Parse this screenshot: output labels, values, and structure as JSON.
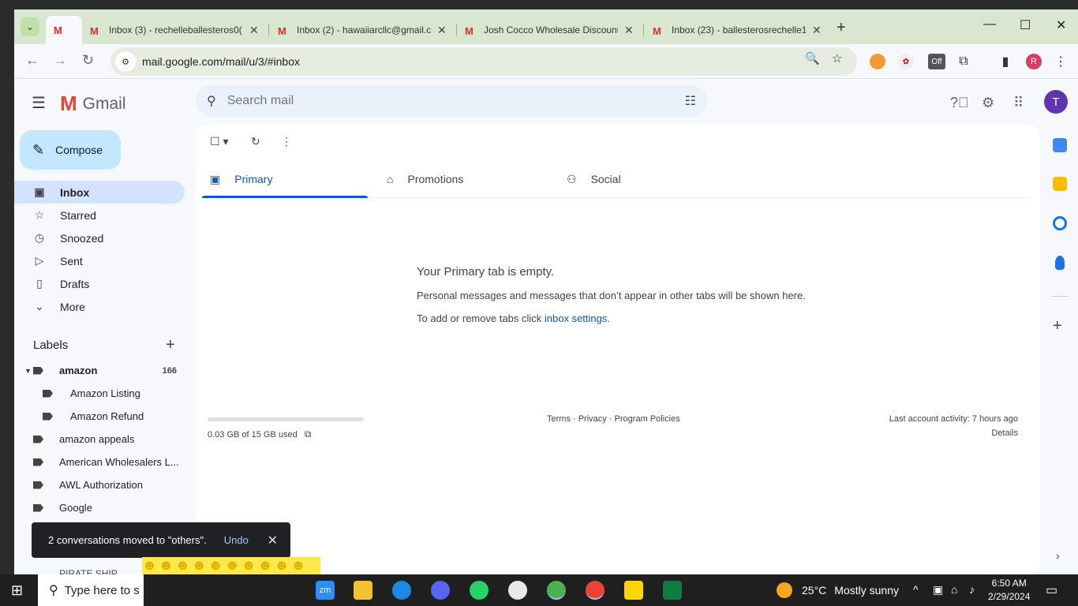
{
  "browser": {
    "tabs": [
      {
        "title": "",
        "active": true
      },
      {
        "title": "Inbox (3) - rechelleballesteros0(",
        "active": false
      },
      {
        "title": "Inbox (2) - hawaiiarcllc@gmail.c",
        "active": false
      },
      {
        "title": "Josh Cocco Wholesale Discount",
        "active": false
      },
      {
        "title": "Inbox (23) - ballesterosrechelle1",
        "active": false
      }
    ],
    "url": "mail.google.com/mail/u/3/#inbox",
    "profile_initial": "R",
    "ext_badge": "Off"
  },
  "gmail": {
    "brand": "Gmail",
    "search_placeholder": "Search mail",
    "avatar_initial": "T",
    "compose_label": "Compose",
    "nav": [
      {
        "label": "Inbox",
        "icon": "inbox-icon",
        "active": true
      },
      {
        "label": "Starred",
        "icon": "star-icon"
      },
      {
        "label": "Snoozed",
        "icon": "clock-icon"
      },
      {
        "label": "Sent",
        "icon": "send-icon"
      },
      {
        "label": "Drafts",
        "icon": "draft-icon"
      },
      {
        "label": "More",
        "icon": "chevron-down-icon"
      }
    ],
    "labels_title": "Labels",
    "labels": [
      {
        "label": "amazon",
        "count": "166",
        "expanded": true,
        "bold": true,
        "indent": 0
      },
      {
        "label": "Amazon Listing",
        "indent": 1
      },
      {
        "label": "Amazon Refund",
        "indent": 1
      },
      {
        "label": "amazon appeals",
        "indent": 0
      },
      {
        "label": "American Wholesalers L...",
        "indent": 0
      },
      {
        "label": "AWL Authorization",
        "indent": 0
      },
      {
        "label": "Google",
        "indent": 0
      }
    ],
    "partial_label": "PIRATE SHIP",
    "tabs": [
      {
        "label": "Primary",
        "icon": "inbox-tab-icon",
        "active": true
      },
      {
        "label": "Promotions",
        "icon": "tag-icon"
      },
      {
        "label": "Social",
        "icon": "people-icon"
      }
    ],
    "empty": {
      "heading": "Your Primary tab is empty.",
      "line1": "Personal messages and messages that don’t appear in other tabs will be shown here.",
      "line2_prefix": "To add or remove tabs click ",
      "line2_link": "inbox settings",
      "line2_suffix": "."
    },
    "storage": {
      "text": "0.03 GB of 15 GB used",
      "fraction": 0.002
    },
    "footer_links": "Terms · Privacy · Program Policies",
    "last_activity": "Last account activity: 7 hours ago",
    "details": "Details",
    "toast": {
      "message": "2 conversations moved to \"others\".",
      "undo": "Undo"
    }
  },
  "taskbar": {
    "search_text": "Type here to s",
    "weather_temp": "25°C",
    "weather_desc": "Mostly sunny",
    "time": "6:50 AM",
    "date": "2/29/2024",
    "zoom_label": "zm"
  }
}
